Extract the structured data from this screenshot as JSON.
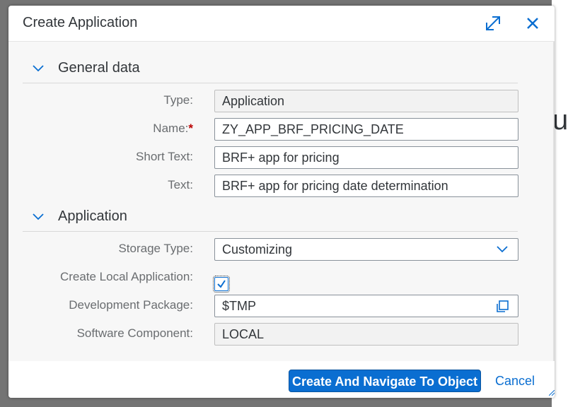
{
  "background": {
    "partial_text": "u"
  },
  "dialog": {
    "title": "Create Application",
    "expand_icon": "expand-icon",
    "close_icon": "close-icon"
  },
  "sections": {
    "general": {
      "title": "General data",
      "type_label": "Type:",
      "type_value": "Application",
      "name_label": "Name:",
      "name_required": "*",
      "name_value": "ZY_APP_BRF_PRICING_DATE",
      "short_text_label": "Short Text:",
      "short_text_value": "BRF+ app for pricing",
      "text_label": "Text:",
      "text_value": "BRF+ app for pricing date determination"
    },
    "application": {
      "title": "Application",
      "storage_type_label": "Storage Type:",
      "storage_type_value": "Customizing",
      "local_app_label": "Create Local Application:",
      "local_app_checked": true,
      "dev_package_label": "Development Package:",
      "dev_package_value": "$TMP",
      "software_component_label": "Software Component:",
      "software_component_value": "LOCAL"
    }
  },
  "footer": {
    "primary_label": "Create And Navigate To Object",
    "cancel_label": "Cancel"
  },
  "colors": {
    "accent": "#0a6ed1",
    "required": "#bb0000",
    "overlay": "#747474"
  }
}
